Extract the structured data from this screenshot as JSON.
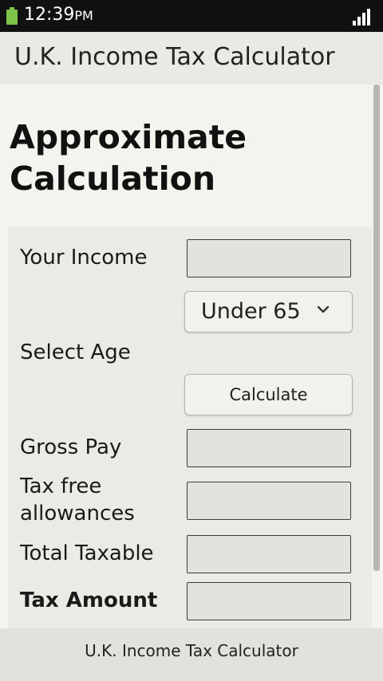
{
  "status_bar": {
    "time": "12:39",
    "ampm": "PM",
    "battery_icon": "battery-icon",
    "signal_icon": "signal-strength-icon"
  },
  "app_bar": {
    "title": "U.K. Income Tax Calculator"
  },
  "content": {
    "heading_line1": "Approximate",
    "heading_line2": "Calculation",
    "form": {
      "your_income_label": "Your Income",
      "your_income_value": "",
      "age_select_value": "Under 65",
      "select_age_label": "Select Age",
      "calculate_label": "Calculate",
      "gross_pay_label": "Gross Pay",
      "gross_pay_value": "",
      "tax_free_label_line1": "Tax free",
      "tax_free_label_line2": "allowances",
      "tax_free_value": "",
      "total_taxable_label": "Total Taxable",
      "total_taxable_value": "",
      "tax_amount_label": "Tax Amount",
      "tax_amount_value": ""
    }
  },
  "footer": {
    "text": "U.K. Income Tax Calculator"
  },
  "colors": {
    "battery": "#7fc24a",
    "status_bar": "#111111",
    "app_bar": "#ebe9e4"
  }
}
